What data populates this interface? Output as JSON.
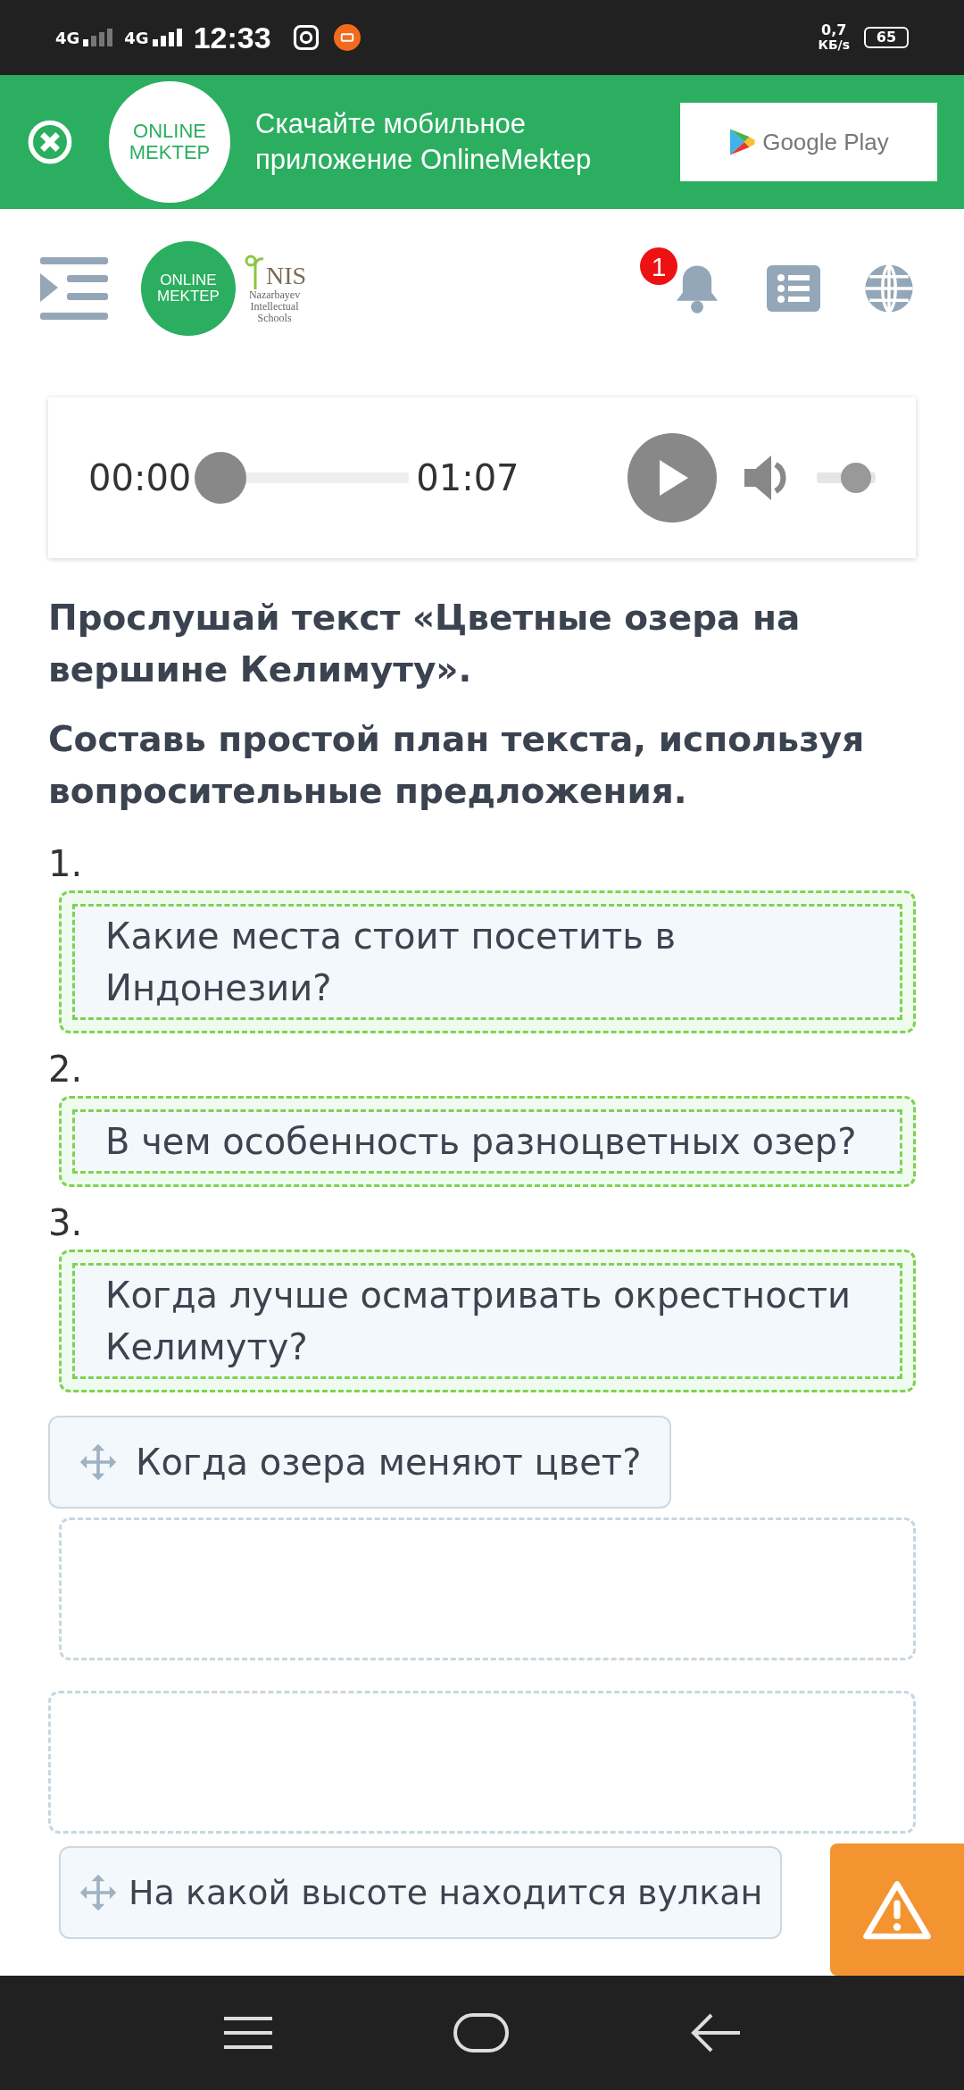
{
  "status_bar": {
    "network_1": "4G",
    "network_2": "4G",
    "time": "12:33",
    "speed": "0,7",
    "speed_unit": "КБ/s",
    "battery": "65"
  },
  "banner": {
    "logo_line_1": "ONLINE",
    "logo_line_2": "MEKTEP",
    "text": "Скачайте мобильное приложение OnlineMektep",
    "store_button": "Google Play"
  },
  "header": {
    "logo_line_1": "ONLINE",
    "logo_line_2": "MEKTEP",
    "nis_logo": "NIS",
    "nis_caption": [
      "Nazarbayev",
      "Intellectual",
      "Schools"
    ],
    "notification_count": "1"
  },
  "audio_player": {
    "current_time": "00:00",
    "duration": "01:07",
    "playing": false,
    "progress": {
      "level": 0
    },
    "volume": {
      "level": 0.85
    }
  },
  "task": {
    "instructions": [
      "Прослушай текст «Цветные озера на вершине Келимуту».",
      "Составь простой план текста, используя вопросительные предложения."
    ]
  },
  "items": [
    {
      "kind": "answer",
      "number": "1.",
      "text": "Какие места стоит посетить в Индонезии?"
    },
    {
      "kind": "answer",
      "number": "2.",
      "text": "В чем особенность разноцветных озер?"
    },
    {
      "kind": "answer",
      "number": "3.",
      "text": "Когда лучше осматривать окрестности Келимуту?"
    },
    {
      "kind": "option",
      "text": "Когда озера меняют цвет?"
    },
    {
      "kind": "drop_zone"
    },
    {
      "kind": "drop_zone"
    },
    {
      "kind": "option",
      "text": "На какой высоте находится вулкан"
    }
  ]
}
